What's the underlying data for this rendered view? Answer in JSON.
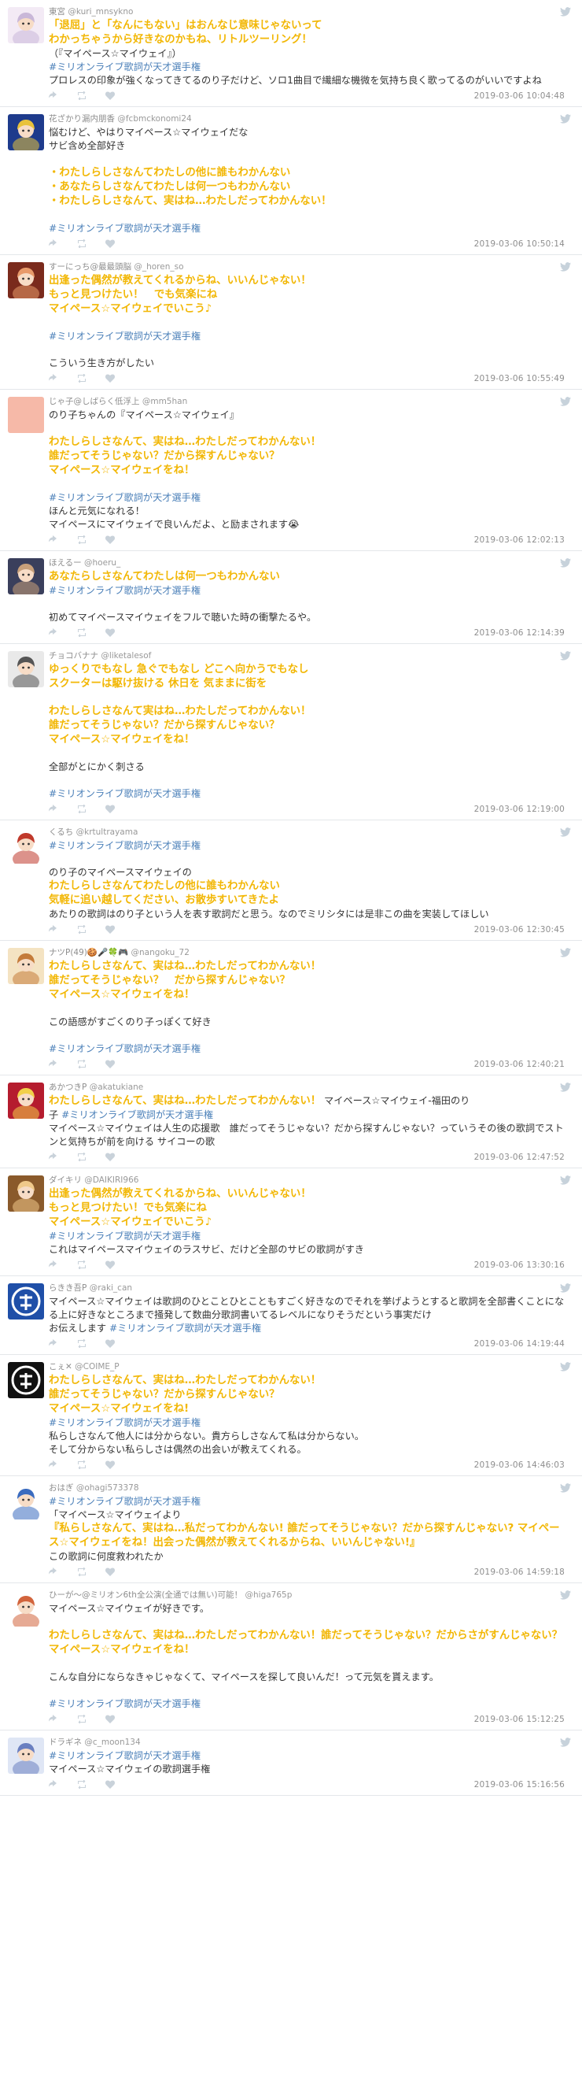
{
  "tweets": [
    {
      "name": "東宮",
      "handle": "@kuri_mnsykno",
      "lines": [
        {
          "s": "hl",
          "t": "「退屈」と「なんにもない」はおんなじ意味じゃないって"
        },
        {
          "s": "hl",
          "t": "わかっちゃうから好きなのかもね、リトルツーリング！"
        },
        {
          "s": "plain",
          "t": "（『マイペース☆マイウェイ』）"
        },
        {
          "s": "tag",
          "t": "#ミリオンライブ歌詞が天才選手権"
        },
        {
          "s": "plain",
          "t": "プロレスの印象が強くなってきてるのり子だけど、ソロ1曲目で繊細な機微を気持ち良く歌ってるのがいいですよね"
        }
      ],
      "time": "2019-03-06 10:04:48",
      "avatar": {
        "bg": "#f3eaf5",
        "fg": "#c9b7d8",
        "icon": "anime-avatar-icon"
      }
    },
    {
      "name": "花ざかり漏内朋香",
      "handle": "@fcbmckonomi24",
      "lines": [
        {
          "s": "plain",
          "t": "悩むけど、やはりマイペース☆マイウェイだな"
        },
        {
          "s": "plain",
          "t": "サビ含め全部好き"
        },
        {
          "s": "blank",
          "t": ""
        },
        {
          "s": "hl",
          "t": "・わたしらしさなんてわたしの他に誰もわかんない"
        },
        {
          "s": "hl",
          "t": "・あなたらしさなんてわたしは何一つもわかんない"
        },
        {
          "s": "hl",
          "t": "・わたしらしさなんて、実はね…わたしだってわかんない！"
        },
        {
          "s": "blank",
          "t": ""
        },
        {
          "s": "tag",
          "t": "#ミリオンライブ歌詞が天才選手権"
        }
      ],
      "time": "2019-03-06 10:50:14",
      "avatar": {
        "bg": "#1e3b8c",
        "fg": "#e8c23b",
        "icon": "anime-avatar-icon"
      }
    },
    {
      "name": "すーにっち@最最頭脳",
      "handle": "@_horen_so",
      "lines": [
        {
          "s": "hl",
          "t": "出逢った偶然が教えてくれるからね、いいんじゃない！"
        },
        {
          "s": "hl",
          "t": "もっと見つけたい！　でも気楽にね"
        },
        {
          "s": "hl",
          "t": "マイペース☆マイウェイでいこう♪"
        },
        {
          "s": "blank",
          "t": ""
        },
        {
          "s": "tag",
          "t": "#ミリオンライブ歌詞が天才選手権"
        },
        {
          "s": "blank",
          "t": ""
        },
        {
          "s": "plain",
          "t": "こういう生き方がしたい"
        }
      ],
      "time": "2019-03-06 10:55:49",
      "avatar": {
        "bg": "#7a2a1c",
        "fg": "#e89a6a",
        "icon": "anime-avatar-icon"
      }
    },
    {
      "name": "じゃ子@しばらく低浮上",
      "handle": "@mm5han",
      "lines": [
        {
          "s": "plain",
          "t": "のり子ちゃんの『マイペース☆マイウェイ』"
        },
        {
          "s": "blank",
          "t": ""
        },
        {
          "s": "hl",
          "t": "わたしらしさなんて、実はね…わたしだってわかんない！"
        },
        {
          "s": "hl",
          "t": "誰だってそうじゃない？だから探すんじゃない？"
        },
        {
          "s": "hl",
          "t": "マイペース☆マイウェイをね！"
        },
        {
          "s": "blank",
          "t": ""
        },
        {
          "s": "tag",
          "t": "#ミリオンライブ歌詞が天才選手権"
        },
        {
          "s": "plain",
          "t": "ほんと元気になれる！"
        },
        {
          "s": "plain",
          "t": "マイペースにマイウェイで良いんだよ、と励まされます😭"
        }
      ],
      "time": "2019-03-06 12:02:13",
      "avatar": {
        "bg": "#f6b9a8",
        "fg": "#f6b9a8",
        "icon": "blank-avatar-icon"
      }
    },
    {
      "name": "ほえるー",
      "handle": "@hoeru_",
      "lines": [
        {
          "s": "hl",
          "t": "あなたらしさなんてわたしは何一つもわかんない"
        },
        {
          "s": "tag",
          "t": "#ミリオンライブ歌詞が天才選手権"
        },
        {
          "s": "blank",
          "t": ""
        },
        {
          "s": "plain",
          "t": "初めてマイペースマイウェイをフルで聴いた時の衝撃たるや。"
        }
      ],
      "time": "2019-03-06 12:14:39",
      "avatar": {
        "bg": "#3a3f5c",
        "fg": "#c8a07a",
        "icon": "anime-avatar-icon"
      }
    },
    {
      "name": "チョコバナナ",
      "handle": "@liketalesof",
      "lines": [
        {
          "s": "hl",
          "t": "ゆっくりでもなし 急ぐでもなし どこへ向かうでもなし"
        },
        {
          "s": "hl",
          "t": "スクーターは駆け抜ける 休日を 気ままに街を"
        },
        {
          "s": "blank",
          "t": ""
        },
        {
          "s": "hl",
          "t": "わたしらしさなんて実はね…わたしだってわかんない！"
        },
        {
          "s": "hl",
          "t": "誰だってそうじゃない？だから探すんじゃない？"
        },
        {
          "s": "hl",
          "t": "マイペース☆マイウェイをね！"
        },
        {
          "s": "blank",
          "t": ""
        },
        {
          "s": "plain",
          "t": "全部がとにかく刺さる"
        },
        {
          "s": "blank",
          "t": ""
        },
        {
          "s": "tag",
          "t": "#ミリオンライブ歌詞が天才選手権"
        }
      ],
      "time": "2019-03-06 12:19:00",
      "avatar": {
        "bg": "#e9e9e9",
        "fg": "#555555",
        "icon": "anime-avatar-icon"
      }
    },
    {
      "name": "くるち",
      "handle": "@krtultrayama",
      "lines": [
        {
          "s": "tag",
          "t": "#ミリオンライブ歌詞が天才選手権"
        },
        {
          "s": "blank",
          "t": ""
        },
        {
          "s": "plain",
          "t": "のり子のマイペースマイウェイの"
        },
        {
          "s": "hl",
          "t": "わたしらしさなんてわたしの他に誰もわかんない"
        },
        {
          "s": "hl",
          "t": "気軽に追い越してください、お散歩すいてきたよ"
        },
        {
          "s": "plain",
          "t": "あたりの歌詞はのり子という人を表す歌詞だと思う。なのでミリシタには是非この曲を実装してほしい"
        }
      ],
      "time": "2019-03-06 12:30:45",
      "avatar": {
        "bg": "#ffffff",
        "fg": "#c0392b",
        "icon": "anime-avatar-icon"
      }
    },
    {
      "name": "ナツP(49)🍪🎤🍀🎮",
      "handle": "@nangoku_72",
      "lines": [
        {
          "s": "hl",
          "t": "わたしらしさなんて、実はね…わたしだってわかんない！"
        },
        {
          "s": "hl",
          "t": "誰だってそうじゃない？　だから探すんじゃない？"
        },
        {
          "s": "hl",
          "t": "マイペース☆マイウェイをね！"
        },
        {
          "s": "blank",
          "t": ""
        },
        {
          "s": "plain",
          "t": "この語感がすごくのり子っぽくて好き"
        },
        {
          "s": "blank",
          "t": ""
        },
        {
          "s": "tag",
          "t": "#ミリオンライブ歌詞が天才選手権"
        }
      ],
      "time": "2019-03-06 12:40:21",
      "avatar": {
        "bg": "#f4e3c2",
        "fg": "#c47b3a",
        "icon": "anime-avatar-icon"
      }
    },
    {
      "name": "あかつきP",
      "handle": "@akatukiane",
      "lines": [
        {
          "s": "mix",
          "parts": [
            {
              "s": "hl",
              "t": "わたしらしさなんて、実はね…わたしだってわかんない！"
            },
            {
              "s": "plain",
              "t": " マイペース☆マイウェイ-福田のり"
            }
          ]
        },
        {
          "s": "mix",
          "parts": [
            {
              "s": "plain",
              "t": "子 "
            },
            {
              "s": "tag",
              "t": "#ミリオンライブ歌詞が天才選手権"
            }
          ]
        },
        {
          "s": "plain",
          "t": "マイペース☆マイウェイは人生の応援歌　誰だってそうじゃない？だから探すんじゃない？っていうその後の歌詞でストンと気持ちが前を向ける サイコーの歌"
        }
      ],
      "time": "2019-03-06 12:47:52",
      "avatar": {
        "bg": "#b51c2e",
        "fg": "#f2d04a",
        "icon": "anime-avatar-icon"
      }
    },
    {
      "name": "ダイキリ",
      "handle": "@DAIKIRI966",
      "lines": [
        {
          "s": "hl",
          "t": "出逢った偶然が教えてくれるからね、いいんじゃない！"
        },
        {
          "s": "hl",
          "t": "もっと見つけたい！でも気楽にね"
        },
        {
          "s": "hl",
          "t": "マイペース☆マイウェイでいこう♪"
        },
        {
          "s": "tag",
          "t": "#ミリオンライブ歌詞が天才選手権"
        },
        {
          "s": "plain",
          "t": "これはマイペースマイウェイのラスサビ、だけど全部のサビの歌詞がすき"
        }
      ],
      "time": "2019-03-06 13:30:16",
      "avatar": {
        "bg": "#8a5a2b",
        "fg": "#f0c98a",
        "icon": "anime-avatar-icon"
      }
    },
    {
      "name": "らきき吾P",
      "handle": "@raki_can",
      "lines": [
        {
          "s": "plain",
          "t": "マイペース☆マイウェイは歌詞のひとことひとこともすごく好きなのでそれを挙げようとすると歌詞を全部書くことになる上に好きなところまで掻発して数曲分歌詞書いてるレベルになりそうだという事実だけ"
        },
        {
          "s": "mix",
          "parts": [
            {
              "s": "plain",
              "t": "お伝えします "
            },
            {
              "s": "tag",
              "t": "#ミリオンライブ歌詞が天才選手権"
            }
          ]
        }
      ],
      "time": "2019-03-06 14:19:44",
      "avatar": {
        "bg": "#1f4fa8",
        "fg": "#ffffff",
        "icon": "logo-avatar-icon"
      }
    },
    {
      "name": "こぇ✕",
      "handle": "@COIME_P",
      "lines": [
        {
          "s": "hl",
          "t": "わたしらしさなんて、実はね…わたしだってわかんない！"
        },
        {
          "s": "hl",
          "t": "誰だってそうじゃない？だから探すんじゃない？"
        },
        {
          "s": "hl",
          "t": "マイペース☆マイウェイをね!"
        },
        {
          "s": "tag",
          "t": "#ミリオンライブ歌詞が天才選手権"
        },
        {
          "s": "plain",
          "t": "私らしさなんて他人には分からない。貴方らしさなんて私は分からない。"
        },
        {
          "s": "plain",
          "t": "そして分からない私らしさは偶然の出会いが教えてくれる。"
        }
      ],
      "time": "2019-03-06 14:46:03",
      "avatar": {
        "bg": "#111111",
        "fg": "#ffffff",
        "icon": "logo-avatar-icon"
      }
    },
    {
      "name": "おはぎ",
      "handle": "@ohagi573378",
      "lines": [
        {
          "s": "tag",
          "t": "#ミリオンライブ歌詞が天才選手権"
        },
        {
          "s": "plain",
          "t": "「マイペース☆マイウェイより"
        },
        {
          "s": "hl",
          "t": "『私らしさなんて、実はね…私だってわかんない! 誰だってそうじゃない？だから探すんじゃない? マイペース☆マイウェイをね！出会った偶然が教えてくれるからね、いいんじゃない!』"
        },
        {
          "s": "plain",
          "t": "この歌詞に何度救われたか"
        }
      ],
      "time": "2019-03-06 14:59:18",
      "avatar": {
        "bg": "#ffffff",
        "fg": "#3a6bbf",
        "icon": "anime-avatar-icon"
      }
    },
    {
      "name": "ひーが～@ミリオン6th全公演(全通では無い)可能！",
      "handle": "@higa765p",
      "lines": [
        {
          "s": "plain",
          "t": "マイペース☆マイウェイが好きです。"
        },
        {
          "s": "blank",
          "t": ""
        },
        {
          "s": "hl",
          "t": "わたしらしさなんて、実はね…わたしだってわかんない！誰だってそうじゃない？だからさがすんじゃない？マイペース☆マイウェイをね！"
        },
        {
          "s": "blank",
          "t": ""
        },
        {
          "s": "plain",
          "t": "こんな自分にならなきゃじゃなくて、マイペースを探して良いんだ！って元気を貰えます。"
        },
        {
          "s": "blank",
          "t": ""
        },
        {
          "s": "tag",
          "t": "#ミリオンライブ歌詞が天才選手権"
        }
      ],
      "time": "2019-03-06 15:12:25",
      "avatar": {
        "bg": "#ffffff",
        "fg": "#d2643c",
        "icon": "anime-avatar-icon"
      }
    },
    {
      "name": "ドラギネ",
      "handle": "@c_moon134",
      "lines": [
        {
          "s": "tag",
          "t": "#ミリオンライブ歌詞が天才選手権"
        },
        {
          "s": "plain",
          "t": "マイペース☆マイウェイの歌詞選手権"
        }
      ],
      "time": "2019-03-06 15:16:56",
      "avatar": {
        "bg": "#dfe6f5",
        "fg": "#6a7fc0",
        "icon": "anime-avatar-icon"
      }
    }
  ]
}
